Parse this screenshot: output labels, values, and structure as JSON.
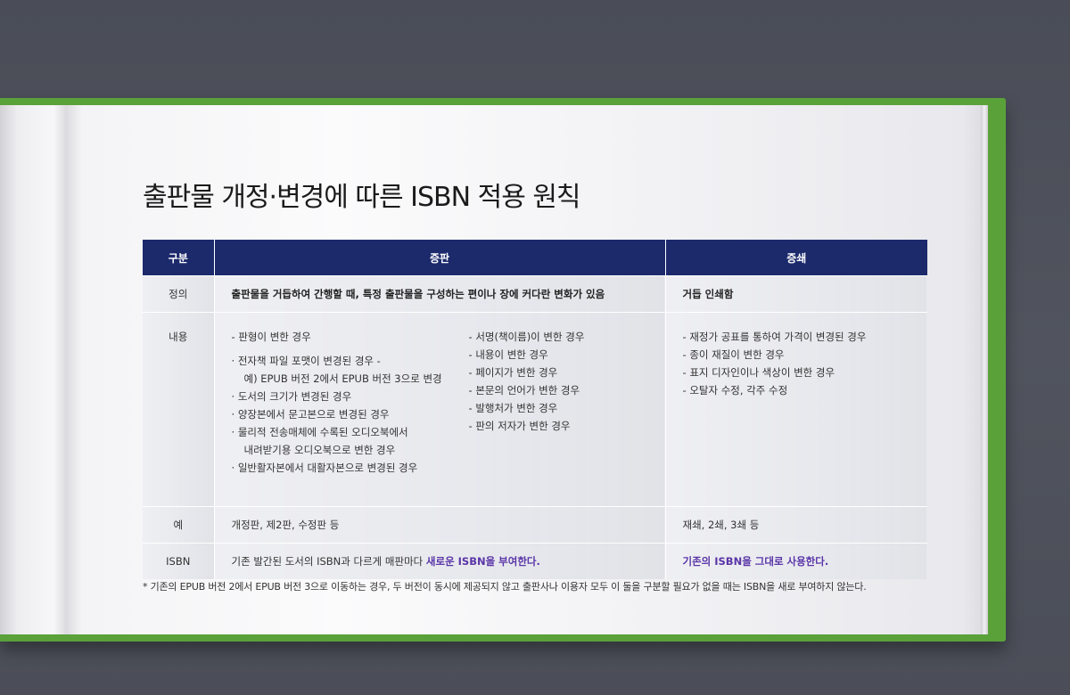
{
  "title": "출판물 개정·변경에 따른 ISBN 적용 원칙",
  "table": {
    "headers": [
      "구분",
      "증판",
      "증쇄"
    ],
    "definition": {
      "label": "정의",
      "edition": "출판물을 거듭하여 간행할 때, 특정 출판물을 구성하는 편이나 장에 커다란 변화가 있음",
      "printing": "거듭 인쇄함"
    },
    "content": {
      "label": "내용",
      "edition_col1": {
        "item1": "판형이 변한 경우",
        "sub1_line1": "전자책 파일 포맷이 변경된 경우 -",
        "sub1_line2": "예) EPUB 버전 2에서 EPUB 버전 3으로 변경",
        "sub2": "도서의 크기가 변경된 경우",
        "sub3": "양장본에서 문고본으로 변경된 경우",
        "sub4_line1": "물리적 전송매체에 수록된 오디오북에서",
        "sub4_line2": "내려받기용 오디오북으로 변한 경우",
        "sub5": "일반활자본에서 대활자본으로 변경된 경우"
      },
      "edition_col2": [
        "서명(책이름)이 변한 경우",
        "내용이 변한 경우",
        "페이지가 변한 경우",
        "본문의 언어가 변한 경우",
        "발행처가 변한 경우",
        "판의 저자가 변한 경우"
      ],
      "printing": [
        "재정가 공표를 통하여 가격이 변경된 경우",
        "종이 재질이 변한 경우",
        "표지 디자인이나 색상이 변한 경우",
        "오탈자 수정, 각주 수정"
      ]
    },
    "example": {
      "label": "예",
      "edition": "개정판, 제2판, 수정판 등",
      "printing": "재쇄, 2쇄, 3쇄 등"
    },
    "isbn": {
      "label": "ISBN",
      "edition_text": "기존 발간된 도서의 ISBN과 다르게 매판마다 ",
      "edition_highlight": "새로운 ISBN을 부여한다.",
      "printing_highlight": "기존의 ISBN을 그대로 사용한다."
    }
  },
  "footnote": "* 기존의 EPUB 버전 2에서 EPUB 버전 3으로 이동하는 경우, 두 버전이 동시에 제공되지 않고 출판사나 이용자 모두 이 둘을 구분할 필요가 없을 때는 ISBN을 새로 부여하지 않는다.",
  "colors": {
    "header_bg": "#1c2a6c",
    "highlight": "#5a35a8",
    "book_cover": "#5aa13a",
    "background": "#4e515b"
  }
}
